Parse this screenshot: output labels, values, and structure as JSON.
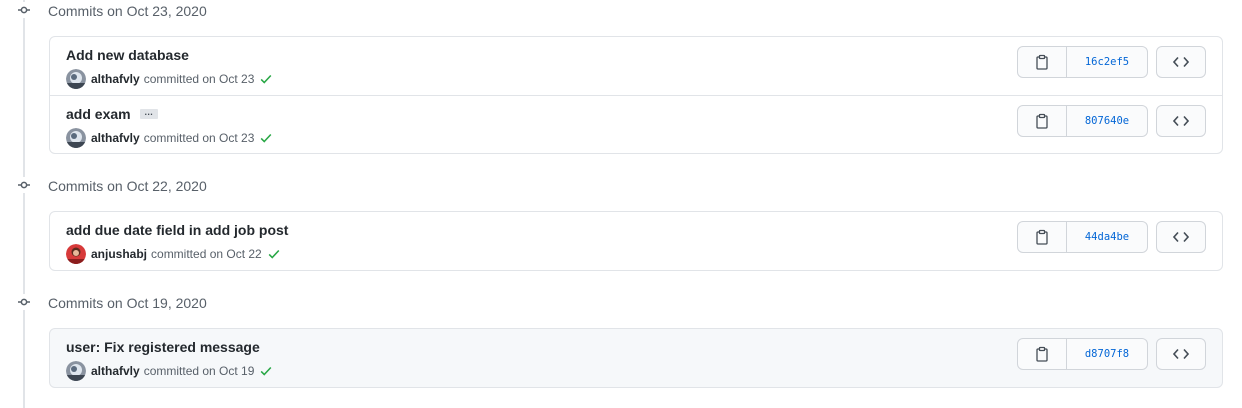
{
  "groups": [
    {
      "title": "Commits on Oct 23, 2020",
      "commits": [
        {
          "message": "Add new database",
          "author": "althafvly",
          "committed": "committed on Oct 23",
          "sha": "16c2ef5"
        },
        {
          "message": "add exam",
          "author": "althafvly",
          "committed": "committed on Oct 23",
          "sha": "807640e",
          "ellipsis": "…"
        }
      ]
    },
    {
      "title": "Commits on Oct 22, 2020",
      "commits": [
        {
          "message": "add due date field in add job post",
          "author": "anjushabj",
          "committed": "committed on Oct 22",
          "sha": "44da4be"
        }
      ]
    },
    {
      "title": "Commits on Oct 19, 2020",
      "commits": [
        {
          "message": "user: Fix registered message",
          "author": "althafvly",
          "committed": "committed on Oct 19",
          "sha": "d8707f8"
        }
      ]
    }
  ],
  "icons": {
    "commit": "git-commit-icon",
    "check": "check-icon",
    "copy": "clipboard-icon",
    "browse": "code-icon"
  },
  "colors": {
    "link": "#0366d6",
    "success": "#28a745",
    "border": "#e1e4e8",
    "muted": "#586069"
  }
}
